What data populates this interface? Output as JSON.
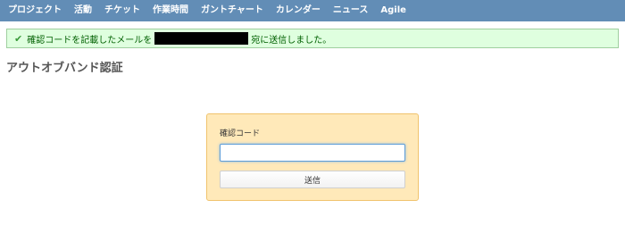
{
  "nav": {
    "items": [
      {
        "label": "プロジェクト"
      },
      {
        "label": "活動"
      },
      {
        "label": "チケット"
      },
      {
        "label": "作業時間"
      },
      {
        "label": "ガントチャート"
      },
      {
        "label": "カレンダー"
      },
      {
        "label": "ニュース"
      },
      {
        "label": "Agile"
      }
    ]
  },
  "flash": {
    "prefix": "確認コードを記載したメールを",
    "suffix": "宛に送信しました。"
  },
  "page": {
    "title": "アウトオブバンド認証"
  },
  "form": {
    "code_label": "確認コード",
    "code_value": "",
    "submit_label": "送信"
  },
  "colors": {
    "nav_background": "#628db6",
    "flash_background": "#dfffdf",
    "form_background": "#ffe9b9"
  }
}
